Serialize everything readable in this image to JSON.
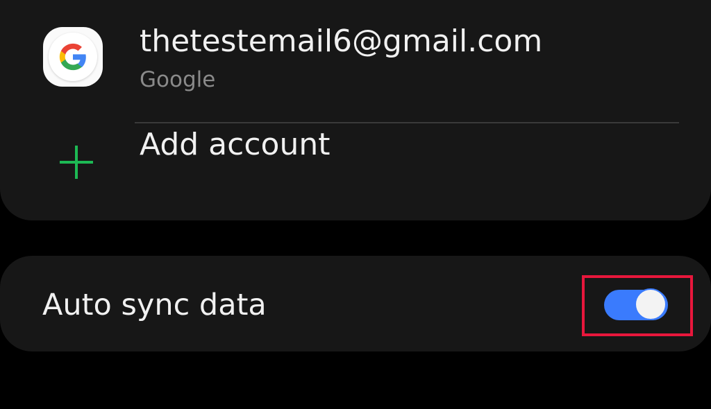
{
  "account": {
    "email": "thetestemail6@gmail.com",
    "type": "Google",
    "icon": "google-icon"
  },
  "add_account": {
    "label": "Add account",
    "icon": "plus-icon",
    "icon_color": "#1db954"
  },
  "auto_sync": {
    "label": "Auto sync data",
    "enabled": true,
    "toggle_color": "#3a7bfd"
  },
  "highlight": {
    "color": "#e8173c",
    "target": "auto-sync-toggle"
  }
}
